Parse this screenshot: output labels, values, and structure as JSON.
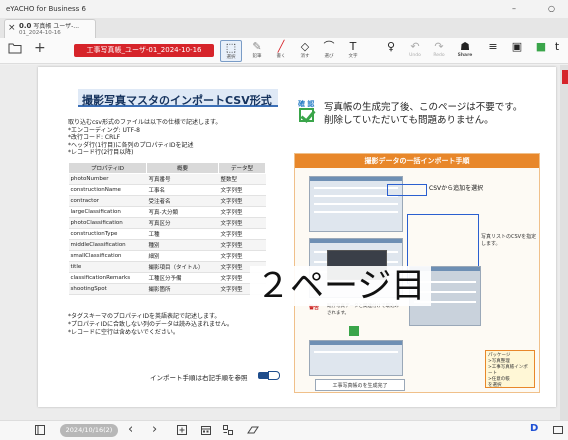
{
  "app": {
    "title": "eYACHO for Business 6"
  },
  "window_controls": {
    "minimize": "–",
    "maximize": "○"
  },
  "tab": {
    "close": "×",
    "page_indicator": "0.0",
    "title": "写真帳 ユーザ-...",
    "subtitle": "01_2024-10-16"
  },
  "toolbar": {
    "folder_icon": "folder-icon",
    "add": "+",
    "document_name": "工事写真帳_ユーザ-01_2024-10-16",
    "tools": [
      {
        "name": "select",
        "glyph": "⬚",
        "label": "選択"
      },
      {
        "name": "pen",
        "glyph": "✎",
        "label": "鉛筆"
      },
      {
        "name": "marker",
        "glyph": "╱",
        "label": "書く"
      },
      {
        "name": "eraser",
        "glyph": "◇",
        "label": "消す"
      },
      {
        "name": "lasso",
        "glyph": "⌒",
        "label": "選び"
      },
      {
        "name": "text",
        "glyph": "T",
        "label": "文字"
      },
      {
        "name": "mic",
        "glyph": "♀",
        "label": ""
      },
      {
        "name": "undo",
        "glyph": "↶",
        "label": "Undo"
      },
      {
        "name": "redo",
        "glyph": "↷",
        "label": "Redo"
      },
      {
        "name": "share",
        "glyph": "☗",
        "label": "Share"
      },
      {
        "name": "menu",
        "glyph": "≡",
        "label": ""
      },
      {
        "name": "panel",
        "glyph": "▣",
        "label": ""
      },
      {
        "name": "bookmark",
        "glyph": "■",
        "label": ""
      },
      {
        "name": "more",
        "glyph": "t",
        "label": ""
      }
    ]
  },
  "page": {
    "title": "撮影写真マスタのインポートCSV形式",
    "intro_lines": [
      "取り込むcsv形式のファイルは以下の仕様で記述します。",
      "*エンコーディング: UTF-8",
      "*改行コード: CRLF",
      "*ヘッダ行(1行目)に各列のプロパティIDを記述",
      "*レコード行(2行目以降)"
    ],
    "confirm_label": "確 認",
    "confirm_lines": [
      "写真帳の生成完了後、このページは不要です。",
      "削除していただいても問題ありません。"
    ],
    "table": {
      "headers": [
        "プロパティID",
        "概要",
        "データ型"
      ],
      "rows": [
        [
          "photoNumber",
          "写真番号",
          "整数型"
        ],
        [
          "constructionName",
          "工事名",
          "文字列型"
        ],
        [
          "contractor",
          "受注者名",
          "文字列型"
        ],
        [
          "largeClassification",
          "写真-大分類",
          "文字列型"
        ],
        [
          "photoClassification",
          "写真区分",
          "文字列型"
        ],
        [
          "constructionType",
          "工種",
          "文字列型"
        ],
        [
          "middleClassification",
          "種別",
          "文字列型"
        ],
        [
          "smallClassification",
          "細別",
          "文字列型"
        ],
        [
          "title",
          "撮影項目（タイトル）",
          "文字列型"
        ],
        [
          "classificationRemarks",
          "工種区分予備",
          "文字列型"
        ],
        [
          "shootingSpot",
          "撮影箇所",
          "文字列型"
        ]
      ]
    },
    "notes": [
      "*タグスキーマのプロパティIDを英語表記で記述します。",
      "*プロパティIDに合致しない列のデータは読み込まれません。",
      "*レコードに空行は含めないでください。"
    ],
    "procedure_ref": "インポート手順は右記手順を参照",
    "import_panel": {
      "header": "撮影データの一括インポート手順",
      "csv_add": "CSVから追加を選択",
      "photo_list": "写真リストのCSVを指定します。",
      "warning": "警告",
      "warning_text": "既存写真データと関連付けで取込みされます。",
      "package_note": "パッケージ\n>写真整理\n>工事写真帳インポート\n>任意の帳\nを選択",
      "create_album": "工事写真帳のを生成完了"
    },
    "overlay": "２ページ目"
  },
  "bottom": {
    "page_date": "2024/10/16(2)",
    "prev": "‹",
    "next": "›",
    "d_label": "D"
  },
  "colors": {
    "accent_red": "#d6242a",
    "title_blue": "#16335e",
    "orange": "#e8872a",
    "green_check": "#3aa54a"
  }
}
